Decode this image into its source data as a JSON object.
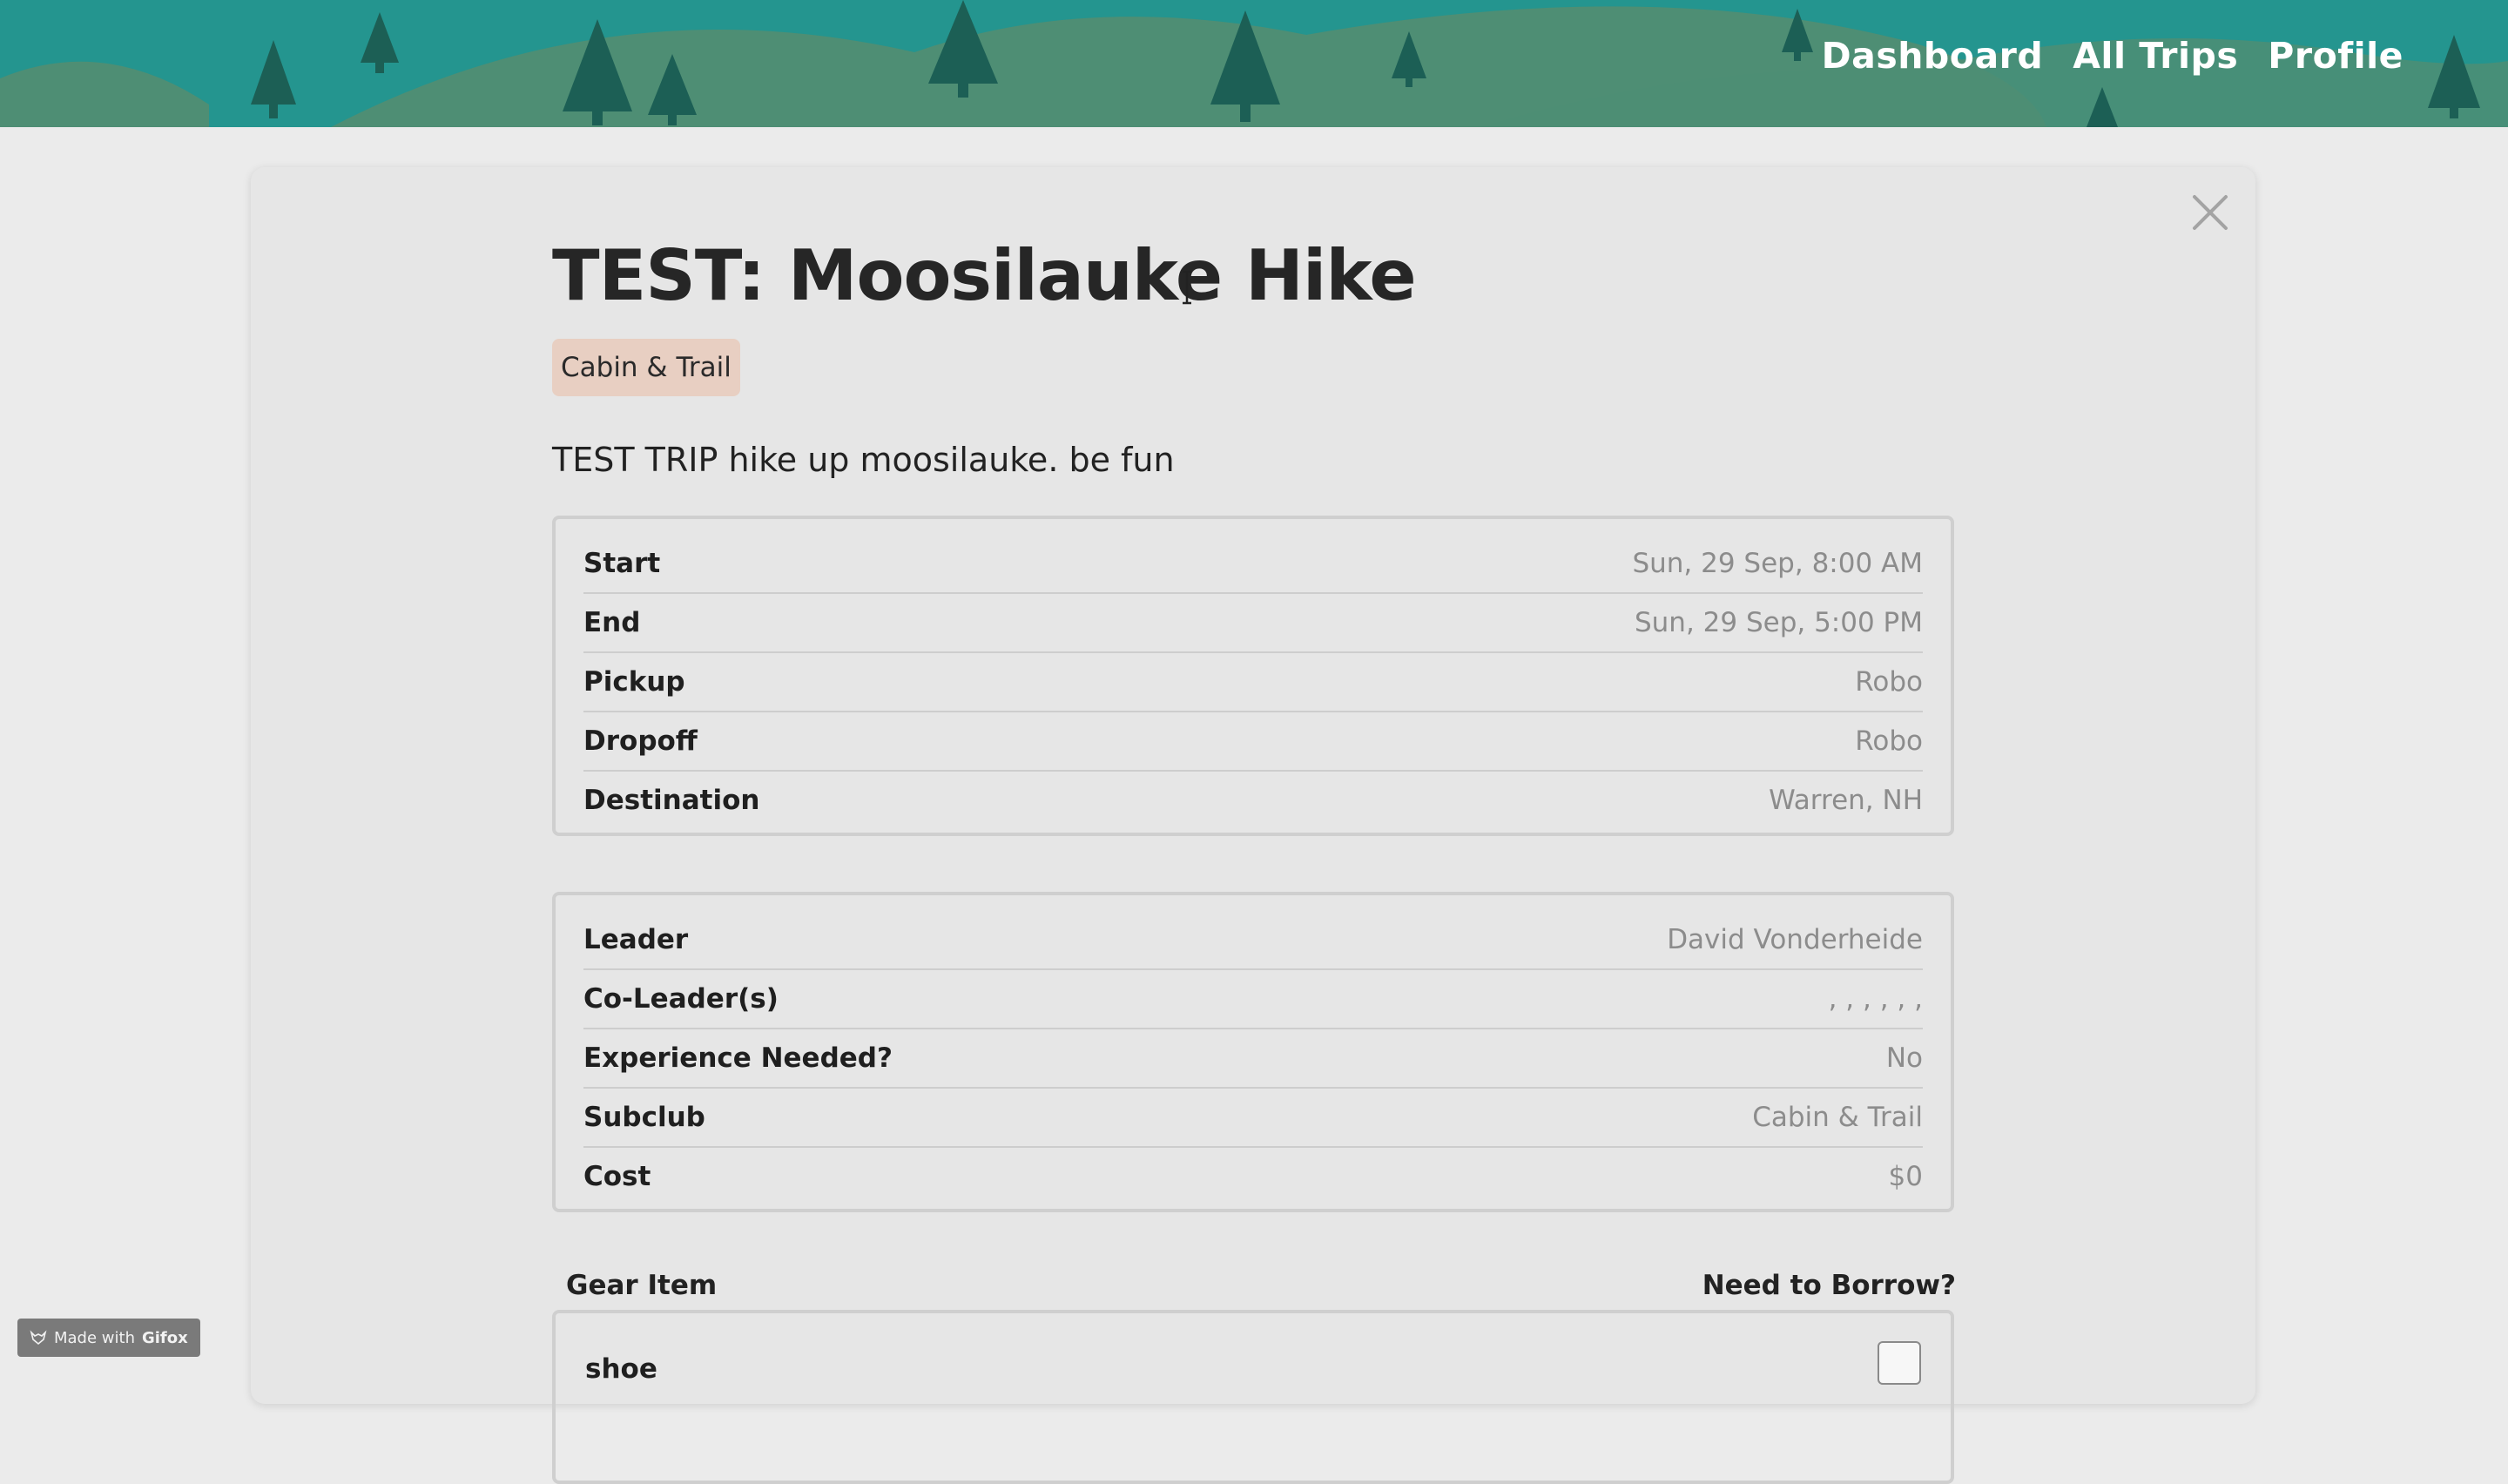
{
  "nav": {
    "dashboard": "Dashboard",
    "all_trips": "All Trips",
    "profile": "Profile"
  },
  "trip": {
    "title": "TEST: Moosilauke Hike",
    "club_tag": "Cabin & Trail",
    "description": "TEST TRIP hike up moosilauke. be fun"
  },
  "details": [
    {
      "label": "Start",
      "value": "Sun, 29 Sep, 8:00 AM"
    },
    {
      "label": "End",
      "value": "Sun, 29 Sep, 5:00 PM"
    },
    {
      "label": "Pickup",
      "value": "Robo"
    },
    {
      "label": "Dropoff",
      "value": "Robo"
    },
    {
      "label": "Destination",
      "value": "Warren, NH"
    }
  ],
  "people": [
    {
      "label": "Leader",
      "value": "David Vonderheide"
    },
    {
      "label": "Co-Leader(s)",
      "value": ", , , , , ,"
    },
    {
      "label": "Experience Needed?",
      "value": "No"
    },
    {
      "label": "Subclub",
      "value": "Cabin & Trail"
    },
    {
      "label": "Cost",
      "value": "$0"
    }
  ],
  "gear": {
    "item_header": "Gear Item",
    "borrow_header": "Need to Borrow?",
    "items": [
      {
        "name": "shoe",
        "borrow": false
      }
    ]
  },
  "watermark": {
    "prefix": "Made with",
    "brand": "Gifox"
  },
  "colors": {
    "header_bg": "#24958f",
    "hill": "#4e8e74",
    "tree": "#1c5f55",
    "tag_bg": "#e8cfc2",
    "card_bg": "#e6e6e6"
  },
  "icons": {
    "close": "close-icon",
    "cursor": "text-cursor-icon",
    "watermark": "fox-icon"
  }
}
